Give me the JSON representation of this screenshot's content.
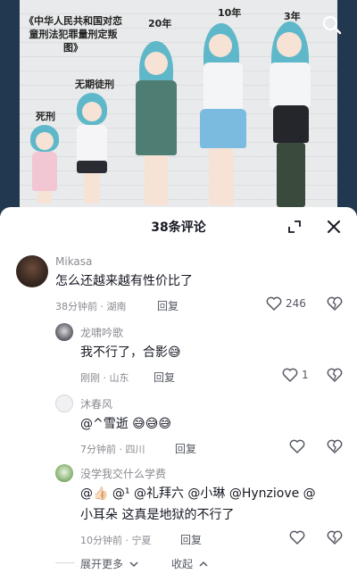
{
  "image": {
    "title_lines": [
      "《中华人民共和国对恋",
      "童刑法犯罪量刑定叛",
      "图》"
    ],
    "labels": {
      "death": "死刑",
      "life": "无期徒刑",
      "twenty": "20年",
      "ten": "10年",
      "three": "3年"
    }
  },
  "sheet": {
    "title": "38条评论"
  },
  "comments": [
    {
      "username": "Mikasa",
      "text": "怎么还越来越有性价比了",
      "meta": "38分钟前 · 湖南",
      "reply": "回复",
      "likes": "246"
    },
    {
      "username": "龙啸吟歌",
      "text": "我不行了，合影😅",
      "meta": "刚刚 · 山东",
      "reply": "回复",
      "likes": "1"
    },
    {
      "username": "沐春风",
      "text": "@^雪逝 😅😅😅",
      "meta": "7分钟前 · 四川",
      "reply": "回复",
      "likes": ""
    },
    {
      "username": "没学我交什么学费",
      "text_line1": "@👍🏻 @¹ @礼拜六 @小琳 @Hynziove @",
      "text_line2": "小耳朵 这真是地狱的不行了",
      "meta": "10分钟前 · 宁夏",
      "reply": "回复",
      "likes": ""
    }
  ],
  "footer": {
    "expand_more": "展开更多",
    "collapse": "收起"
  },
  "colors": {
    "text_primary": "#161823",
    "text_secondary": "#8a8b91",
    "image_background": "#223750",
    "hair": "#5fb8c9"
  }
}
